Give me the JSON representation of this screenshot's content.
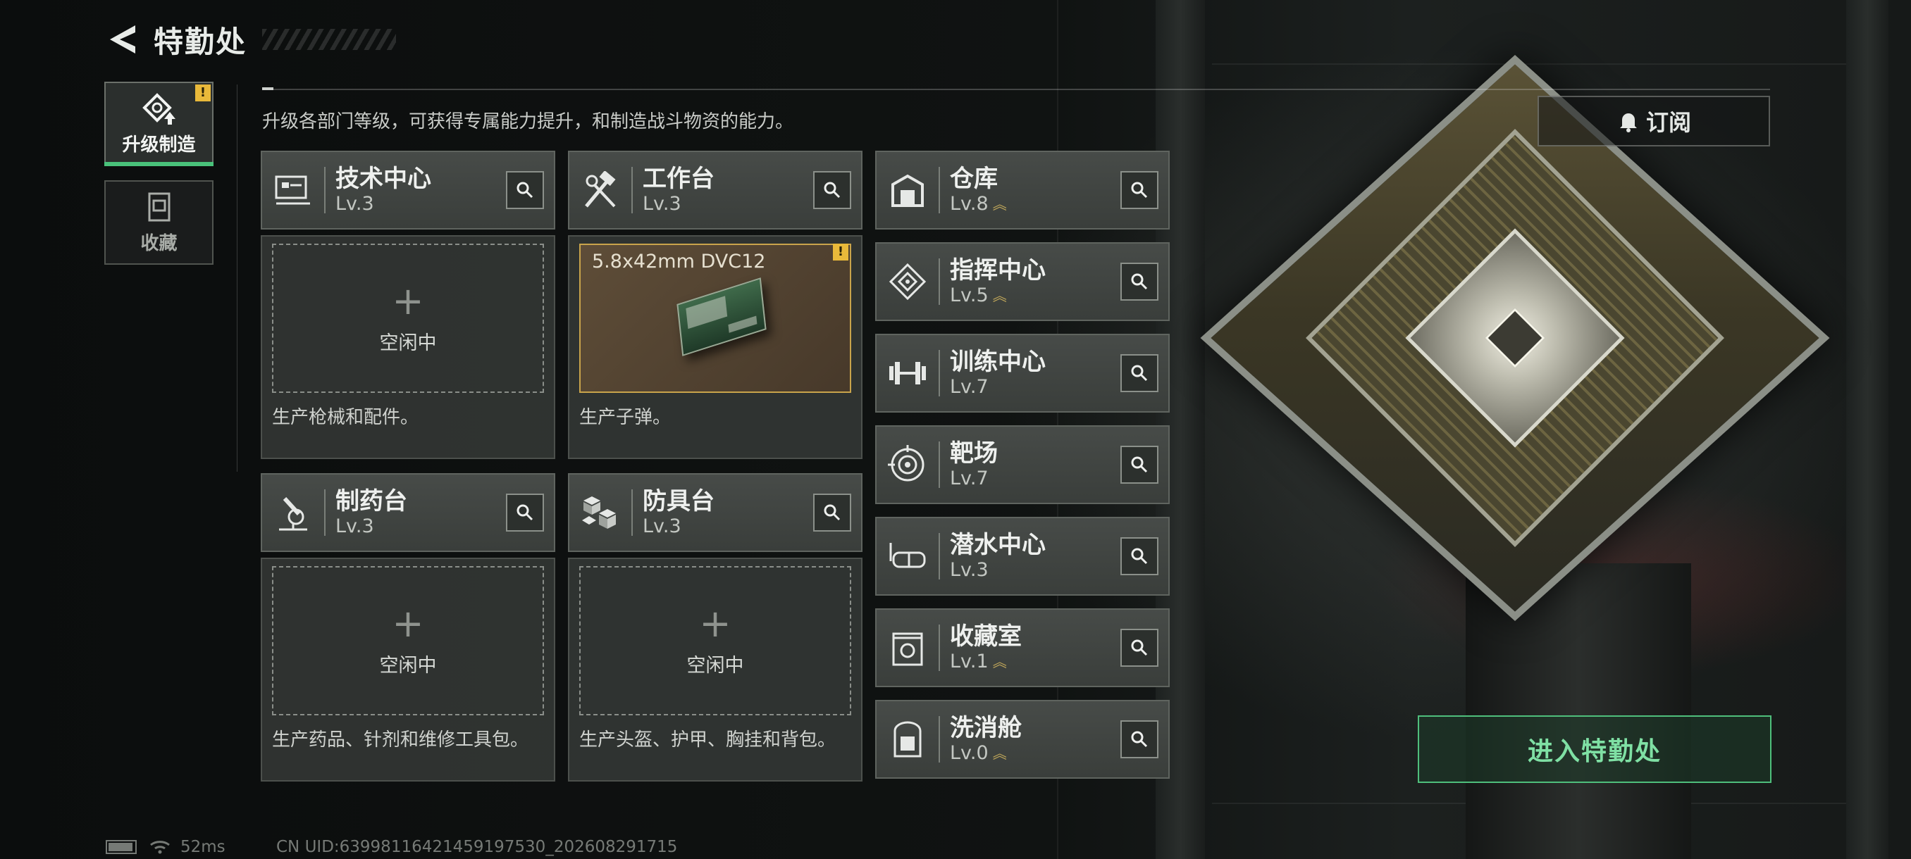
{
  "header": {
    "title": "特勤处"
  },
  "tabs": [
    {
      "label": "升级制造",
      "icon": "upgrade-icon",
      "active": true,
      "alert": "!"
    },
    {
      "label": "收藏",
      "icon": "collection-icon",
      "active": false
    }
  ],
  "subtitle": "升级各部门等级，可获得专属能力提升，和制造战斗物资的能力。",
  "subscribe": {
    "label": "订阅",
    "icon": "bell-icon"
  },
  "production_stations": [
    {
      "name": "技术中心",
      "level": "Lv.3",
      "icon": "tech-center-icon",
      "slot": "空闲中",
      "plus": "+",
      "description": "生产枪械和配件。"
    },
    {
      "name": "工作台",
      "level": "Lv.3",
      "icon": "workbench-icon",
      "slot_item": "5.8x42mm DVC12",
      "alert": "!",
      "description": "生产子弹。"
    },
    {
      "name": "制药台",
      "level": "Lv.3",
      "icon": "pharmacy-icon",
      "slot": "空闲中",
      "plus": "+",
      "description": "生产药品、针剂和维修工具包。"
    },
    {
      "name": "防具台",
      "level": "Lv.3",
      "icon": "armor-bench-icon",
      "slot": "空闲中",
      "plus": "+",
      "description": "生产头盔、护甲、胸挂和背包。"
    }
  ],
  "facilities": [
    {
      "name": "仓库",
      "level": "Lv.8",
      "upgradable": true,
      "icon": "warehouse-icon"
    },
    {
      "name": "指挥中心",
      "level": "Lv.5",
      "upgradable": true,
      "icon": "command-center-icon"
    },
    {
      "name": "训练中心",
      "level": "Lv.7",
      "upgradable": false,
      "icon": "training-icon"
    },
    {
      "name": "靶场",
      "level": "Lv.7",
      "upgradable": false,
      "icon": "target-icon"
    },
    {
      "name": "潜水中心",
      "level": "Lv.3",
      "upgradable": false,
      "icon": "diving-icon"
    },
    {
      "name": "收藏室",
      "level": "Lv.1",
      "upgradable": true,
      "icon": "collection-room-icon"
    },
    {
      "name": "洗消舱",
      "level": "Lv.0",
      "upgradable": true,
      "icon": "decon-icon"
    }
  ],
  "enter_button": {
    "label": "进入特勤处"
  },
  "status_bar": {
    "ping": "52ms",
    "uid": "CN UID:63998116421459197530_202608291715"
  },
  "colors": {
    "accent_green": "#49c27a",
    "alert_yellow": "#e9b93a",
    "upgrade_gold": "#c2a85a"
  }
}
